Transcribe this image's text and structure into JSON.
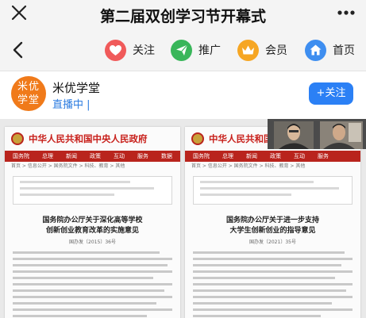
{
  "window": {
    "title": "第二届双创学习节开幕式"
  },
  "toolbar": {
    "follow_label": "关注",
    "share_label": "推广",
    "member_label": "会员",
    "home_label": "首页"
  },
  "channel": {
    "avatar_text_line1": "米优",
    "avatar_text_line2": "学堂",
    "name": "米优学堂",
    "status": "直播中 |",
    "follow_button": "+关注"
  },
  "video": {
    "left_doc": {
      "gov_name": "中华人民共和国中央人民政府",
      "nav": [
        "国务院",
        "总理",
        "新闻",
        "政策",
        "互动",
        "服务",
        "数据"
      ],
      "breadcrumb": "首页 > 信息公开 > 国务院文件 > 科技、教育 > 其他",
      "title_line1": "国务院办公厅关于深化高等学校",
      "title_line2": "创新创业教育改革的实施意见",
      "doc_number": "国办发〔2015〕36号"
    },
    "right_doc": {
      "gov_name": "中华人民共和国中央",
      "nav": [
        "国务院",
        "总理",
        "新闻",
        "政策",
        "互动",
        "服务"
      ],
      "breadcrumb": "首页 > 信息公开 > 国务院文件 > 科技、教育 > 其他",
      "title_line1": "国务院办公厅关于进一步支持",
      "title_line2": "大学生创新创业的指导意见",
      "doc_number": "国办发〔2021〕35号"
    }
  },
  "colors": {
    "accent_blue": "#2b80f5",
    "gov_red": "#c8201b",
    "avatar_orange": "#f07a1a"
  },
  "icons": {
    "close": "close-icon",
    "more": "more-icon",
    "back": "back-arrow-icon",
    "follow": "heart-icon",
    "share": "paper-plane-icon",
    "member": "crown-icon",
    "home": "home-icon"
  }
}
